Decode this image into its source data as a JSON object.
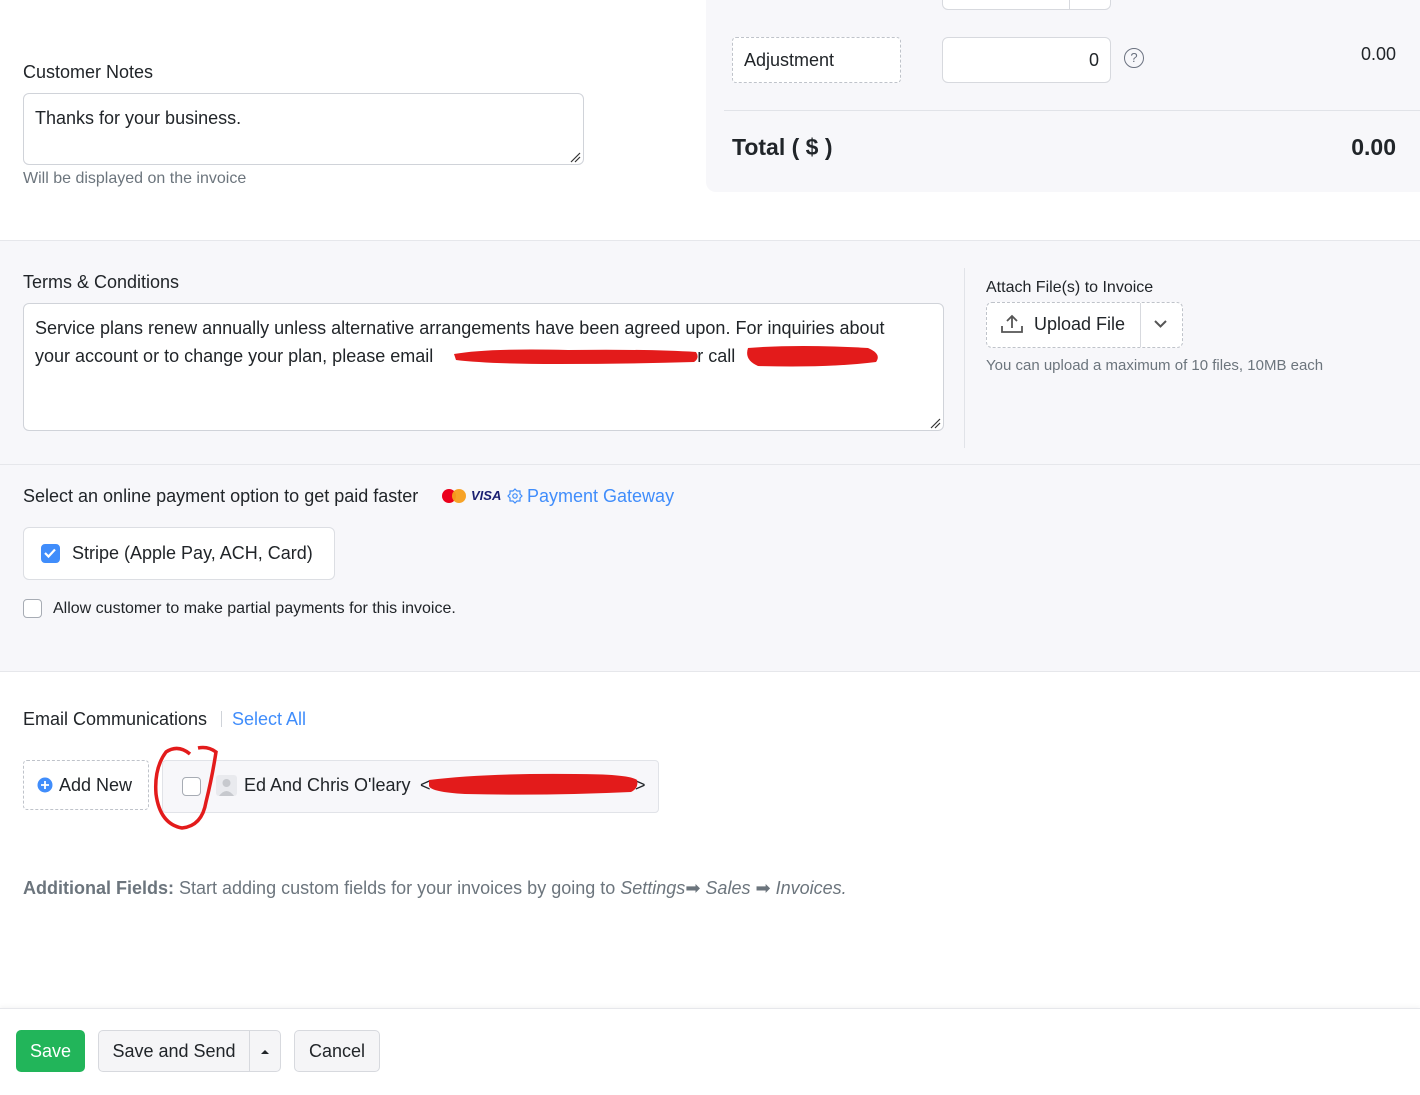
{
  "summary": {
    "adjustment_label": "Adjustment",
    "adjustment_input": "0",
    "adjustment_value": "0.00",
    "help_glyph": "?",
    "total_label": "Total ( $ )",
    "total_value": "0.00"
  },
  "customer_notes": {
    "label": "Customer Notes",
    "value": "Thanks for your business.",
    "hint": "Will be displayed on the invoice"
  },
  "terms": {
    "label": "Terms & Conditions",
    "line1": "Service plans renew annually unless alternative arrangements have been agreed upon. For inquiries about",
    "line2_a": "your account or to change your plan, please email",
    "line2_b": "or call"
  },
  "attachments": {
    "label": "Attach File(s) to Invoice",
    "upload_label": "Upload File",
    "hint": "You can upload a maximum of 10 files, 10MB each"
  },
  "payment": {
    "prompt": "Select an online payment option to get paid faster",
    "visa_label": "VISA",
    "gateway_link": "Payment Gateway",
    "stripe_label": "Stripe (Apple Pay, ACH, Card)",
    "stripe_checked": true,
    "partial_label": "Allow customer to make partial payments for this invoice.",
    "partial_checked": false
  },
  "email": {
    "label": "Email Communications",
    "select_all": "Select All",
    "add_new": "Add New",
    "contact_name": "Ed And Chris O'leary",
    "contact_open": "<",
    "contact_close": ">",
    "contact_checked": false
  },
  "additional_fields": {
    "bold_label": "Additional Fields:",
    "text": "Start adding custom fields for your invoices by going to",
    "path_1": "Settings",
    "path_2": "Sales",
    "path_3": "Invoices.",
    "arrow": "➡"
  },
  "footer": {
    "save": "Save",
    "save_and_send": "Save and Send",
    "cancel": "Cancel"
  },
  "colors": {
    "accent": "#408dfb",
    "primary_button": "#22b55a",
    "annotation_red": "#e31b1b"
  }
}
